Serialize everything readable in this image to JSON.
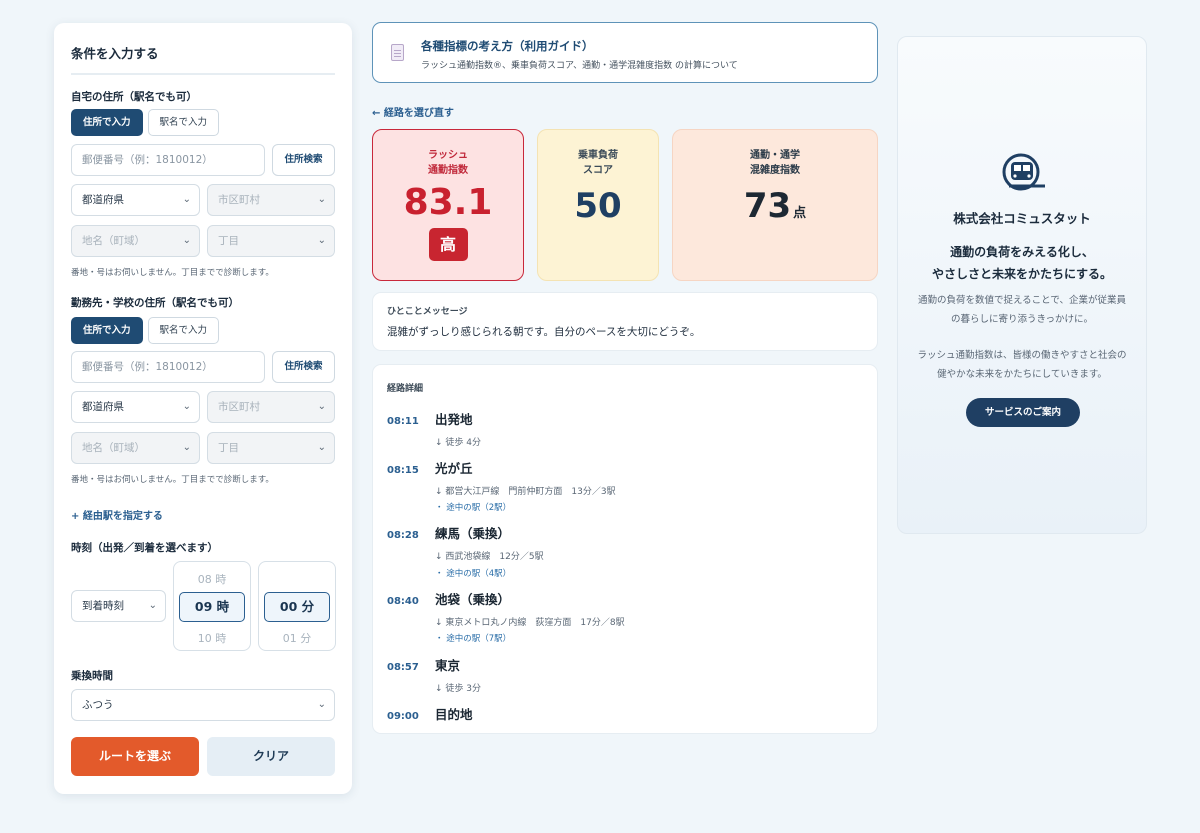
{
  "form": {
    "title": "条件を入力する",
    "home": {
      "label": "自宅の住所（駅名でも可）",
      "mode_address": "住所で入力",
      "mode_station": "駅名で入力",
      "postal_placeholder": "郵便番号（例：1810012）",
      "search_button": "住所検索",
      "prefecture": "都道府県",
      "city": "市区町村",
      "town": "地名（町域）",
      "chome": "丁目",
      "note": "番地・号はお伺いしません。丁目までで診断します。"
    },
    "work": {
      "label": "勤務先・学校の住所（駅名でも可）",
      "mode_address": "住所で入力",
      "mode_station": "駅名で入力",
      "postal_placeholder": "郵便番号（例：1810012）",
      "search_button": "住所検索",
      "prefecture": "都道府県",
      "city": "市区町村",
      "town": "地名（町域）",
      "chome": "丁目",
      "note": "番地・号はお伺いしません。丁目までで診断します。"
    },
    "add_via": "+ 経由駅を指定する",
    "time_label": "時刻（出発／到着を選べます）",
    "time_mode": "到着時刻",
    "hour_prev": "08 時",
    "hour": "09 時",
    "hour_next": "10 時",
    "minute": "00 分",
    "minute_next": "01 分",
    "transfer_label": "乗換時間",
    "transfer_value": "ふつう",
    "submit": "ルートを選ぶ",
    "clear": "クリア"
  },
  "guide": {
    "title": "各種指標の考え方（利用ガイド）",
    "subtitle": "ラッシュ通勤指数®、乗車負荷スコア、通勤・通学混雑度指数 の計算について"
  },
  "back_link": "← 経路を選び直す",
  "scores": {
    "rush": {
      "label1": "ラッシュ",
      "label2": "通勤指数",
      "value": "83.1",
      "level": "高"
    },
    "load": {
      "label1": "乗車負荷",
      "label2": "スコア",
      "value": "50"
    },
    "crowd": {
      "label1": "通勤・通学",
      "label2": "混雑度指数",
      "value": "73",
      "unit": "点"
    }
  },
  "message": {
    "heading": "ひとことメッセージ",
    "text": "混雑がずっしり感じられる朝です。自分のペースを大切にどうぞ。"
  },
  "route": {
    "heading": "経路詳細",
    "stops": [
      {
        "time": "08:11",
        "name": "出発地"
      },
      {
        "time": "08:15",
        "name": "光が丘"
      },
      {
        "time": "08:28",
        "name": "練馬（乗換）"
      },
      {
        "time": "08:40",
        "name": "池袋（乗換）"
      },
      {
        "time": "08:57",
        "name": "東京"
      },
      {
        "time": "09:00",
        "name": "目的地"
      }
    ],
    "legs": [
      {
        "text": "↓ 徒歩 4分"
      },
      {
        "text": "↓ 都営大江戸線　門前仲町方面　13分／3駅",
        "via": "・ 途中の駅（2駅）"
      },
      {
        "text": "↓ 西武池袋線　12分／5駅",
        "via": "・ 途中の駅（4駅）"
      },
      {
        "text": "↓ 東京メトロ丸ノ内線　荻窪方面　17分／8駅",
        "via": "・ 途中の駅（7駅）"
      },
      {
        "text": "↓ 徒歩 3分"
      }
    ]
  },
  "company": {
    "name": "株式会社コミュスタット",
    "tagline1": "通勤の負荷をみえる化し、",
    "tagline2": "やさしさと未来をかたちにする。",
    "body1": "通勤の負荷を数値で捉えることで、企業が従業員の暮らしに寄り添うきっかけに。",
    "body2": "ラッシュ通勤指数は、皆様の働きやすさと社会の健やかな未来をかたちにしていきます。",
    "cta": "サービスのご案内",
    "logo_icon": "train-icon"
  },
  "colors": {
    "primary": "#1f4b73",
    "accent": "#e35a2b",
    "danger": "#c9212f"
  }
}
